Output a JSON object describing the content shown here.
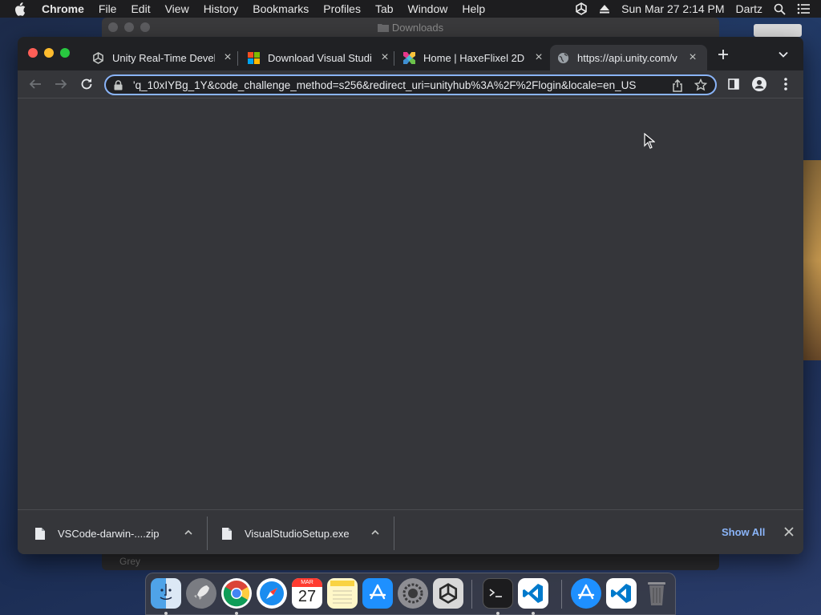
{
  "menubar": {
    "app_name": "Chrome",
    "menus": [
      "File",
      "Edit",
      "View",
      "History",
      "Bookmarks",
      "Profiles",
      "Tab",
      "Window",
      "Help"
    ],
    "clock": "Sun Mar 27  2:14 PM",
    "user": "Dartz"
  },
  "finder": {
    "title": "Downloads",
    "bottom_text": "Grey"
  },
  "chrome": {
    "tabs": [
      {
        "title": "Unity Real-Time Develo",
        "favicon": "unity-icon",
        "active": false
      },
      {
        "title": "Download Visual Studio",
        "favicon": "microsoft-icon",
        "active": false
      },
      {
        "title": "Home | HaxeFlixel 2D G",
        "favicon": "haxeflixel-icon",
        "active": false
      },
      {
        "title": "https://api.unity.com/v",
        "favicon": "globe-icon",
        "active": true
      }
    ],
    "omnibox": {
      "url": "'q_10xIYBg_1Y&code_challenge_method=s256&redirect_uri=unityhub%3A%2F%2Flogin&locale=en_US"
    },
    "downloads": [
      {
        "name": "VSCode-darwin-....zip"
      },
      {
        "name": "VisualStudioSetup.exe"
      }
    ],
    "show_all_label": "Show All"
  },
  "dock": {
    "apps": [
      "finder-icon",
      "launchpad-icon",
      "chrome-icon",
      "safari-icon",
      "calendar-icon",
      "notes-icon",
      "app-store-icon",
      "system-preferences-icon",
      "unity-hub-icon",
      "terminal-icon",
      "vscode-icon",
      "app-store-download-icon",
      "vscode-download-icon",
      "trash-icon"
    ],
    "calendar": {
      "month": "MAR",
      "day": "27"
    }
  }
}
